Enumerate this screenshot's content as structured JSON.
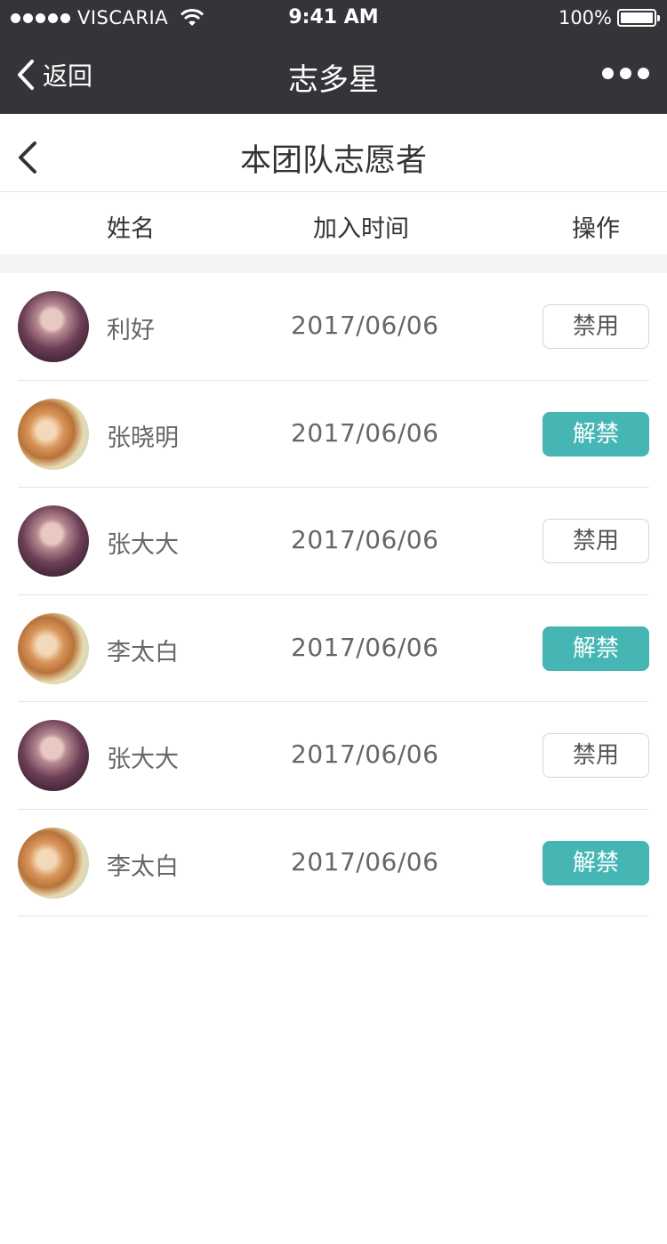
{
  "status_bar": {
    "carrier": "VISCARIA",
    "time": "9:41 AM",
    "battery": "100%"
  },
  "nav": {
    "back_label": "返回",
    "title": "志多星"
  },
  "page": {
    "title": "本团队志愿者"
  },
  "table": {
    "headers": {
      "name": "姓名",
      "join_time": "加入时间",
      "action": "操作"
    },
    "rows": [
      {
        "name": "利好",
        "date": "2017/06/06",
        "action": "禁用",
        "action_style": "disable",
        "avatar": "avatar-a"
      },
      {
        "name": "张晓明",
        "date": "2017/06/06",
        "action": "解禁",
        "action_style": "enable",
        "avatar": "avatar-b"
      },
      {
        "name": "张大大",
        "date": "2017/06/06",
        "action": "禁用",
        "action_style": "disable",
        "avatar": "avatar-a"
      },
      {
        "name": "李太白",
        "date": "2017/06/06",
        "action": "解禁",
        "action_style": "enable",
        "avatar": "avatar-b"
      },
      {
        "name": "张大大",
        "date": "2017/06/06",
        "action": "禁用",
        "action_style": "disable",
        "avatar": "avatar-a"
      },
      {
        "name": "李太白",
        "date": "2017/06/06",
        "action": "解禁",
        "action_style": "enable",
        "avatar": "avatar-b"
      }
    ]
  },
  "colors": {
    "header_bg": "#333538",
    "accent": "#45b6b4"
  }
}
